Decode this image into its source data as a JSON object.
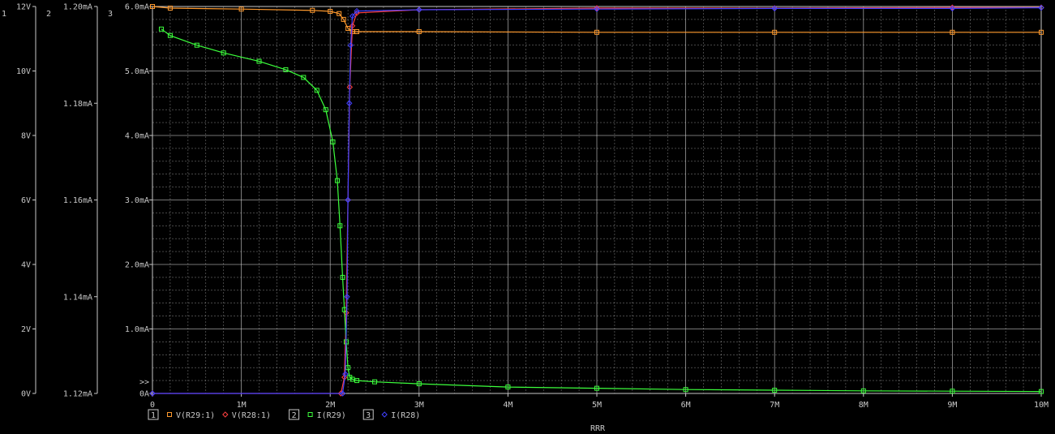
{
  "colors": {
    "background": "#000000",
    "axis": "#c8c8c8",
    "grid": "#d0d0d0",
    "series_v_r29": "#ff9a2e",
    "series_v_r28": "#ff4040",
    "series_i_r29": "#3cff3c",
    "series_i_r28": "#4040ff"
  },
  "axes_ids": [
    "1",
    "2",
    "3"
  ],
  "marker_symbol": ">>",
  "chart_data": {
    "type": "line",
    "xlabel": "RRR",
    "xlim": [
      0,
      10000000
    ],
    "xticks": [
      0,
      1000000,
      2000000,
      3000000,
      4000000,
      5000000,
      6000000,
      7000000,
      8000000,
      9000000,
      10000000
    ],
    "xticklabels": [
      "0",
      "1M",
      "2M",
      "3M",
      "4M",
      "5M",
      "6M",
      "7M",
      "8M",
      "9M",
      "10M"
    ],
    "grid": true,
    "legend_placement": "bottom",
    "yaxes": [
      {
        "id": "1",
        "ylim": [
          0,
          12
        ],
        "ticks": [
          0,
          2,
          4,
          6,
          8,
          10,
          12
        ],
        "ticklabels": [
          "0V",
          "2V",
          "4V",
          "6V",
          "8V",
          "10V",
          "12V"
        ]
      },
      {
        "id": "2",
        "ylim": [
          1.12,
          1.2
        ],
        "ticks": [
          1.12,
          1.14,
          1.16,
          1.18,
          1.2
        ],
        "ticklabels": [
          "1.12mA",
          "1.14mA",
          "1.16mA",
          "1.18mA",
          "1.20mA"
        ]
      },
      {
        "id": "3",
        "ylim": [
          0,
          6
        ],
        "ticks": [
          0,
          1,
          2,
          3,
          4,
          5,
          6
        ],
        "ticklabels": [
          "0A",
          "1.0mA",
          "2.0mA",
          "3.0mA",
          "4.0mA",
          "5.0mA",
          "6.0mA"
        ]
      }
    ],
    "legend": [
      {
        "axis_id": "1",
        "entries": [
          {
            "series": "V(R29:1)",
            "marker": "square",
            "color": "#ff9a2e"
          },
          {
            "series": "V(R28:1)",
            "marker": "diamond",
            "color": "#ff4040"
          }
        ]
      },
      {
        "axis_id": "2",
        "entries": [
          {
            "series": "I(R29)",
            "marker": "square",
            "color": "#3cff3c"
          }
        ]
      },
      {
        "axis_id": "3",
        "entries": [
          {
            "series": "I(R28)",
            "marker": "diamond",
            "color": "#4040ff"
          }
        ]
      }
    ],
    "series": [
      {
        "name": "V(R29:1)",
        "axis": "1",
        "color": "#ff9a2e",
        "marker": "square",
        "x": [
          0,
          200000,
          1000000,
          1800000,
          2000000,
          2100000,
          2150000,
          2200000,
          2250000,
          2300000,
          3000000,
          5000000,
          7000000,
          9000000,
          10000000
        ],
        "y": [
          12.0,
          11.95,
          11.92,
          11.88,
          11.85,
          11.78,
          11.6,
          11.32,
          11.22,
          11.22,
          11.22,
          11.2,
          11.2,
          11.2,
          11.2
        ]
      },
      {
        "name": "V(R28:1)",
        "axis": "1",
        "color": "#ff4040",
        "marker": "diamond",
        "x": [
          0,
          2120000,
          2160000,
          2180000,
          2200000,
          2220000,
          2250000,
          2300000,
          3000000,
          5000000,
          7000000,
          9000000,
          10000000
        ],
        "y": [
          0,
          0,
          0.5,
          2.5,
          6.0,
          9.5,
          11.4,
          11.8,
          11.9,
          11.95,
          11.95,
          11.97,
          11.97
        ]
      },
      {
        "name": "I(R29)",
        "axis": "3",
        "color": "#3cff3c",
        "marker": "square",
        "x": [
          100000,
          200000,
          500000,
          800000,
          1200000,
          1500000,
          1700000,
          1850000,
          1950000,
          2030000,
          2080000,
          2110000,
          2140000,
          2160000,
          2180000,
          2200000,
          2220000,
          2250000,
          2300000,
          2500000,
          3000000,
          4000000,
          5000000,
          6000000,
          7000000,
          8000000,
          9000000,
          10000000
        ],
        "y": [
          5.65,
          5.55,
          5.4,
          5.28,
          5.15,
          5.02,
          4.9,
          4.7,
          4.4,
          3.9,
          3.3,
          2.6,
          1.8,
          1.3,
          0.8,
          0.4,
          0.25,
          0.22,
          0.2,
          0.18,
          0.15,
          0.1,
          0.08,
          0.06,
          0.05,
          0.04,
          0.035,
          0.03
        ]
      },
      {
        "name": "I(R28)",
        "axis": "3",
        "color": "#4040ff",
        "marker": "diamond",
        "x": [
          0,
          2140000,
          2170000,
          2190000,
          2200000,
          2215000,
          2230000,
          2250000,
          2300000,
          3000000,
          5000000,
          7000000,
          9000000,
          10000000
        ],
        "y": [
          0,
          0,
          0.3,
          1.5,
          3.0,
          4.5,
          5.4,
          5.85,
          5.93,
          5.95,
          5.96,
          5.97,
          5.97,
          5.98
        ]
      }
    ]
  }
}
